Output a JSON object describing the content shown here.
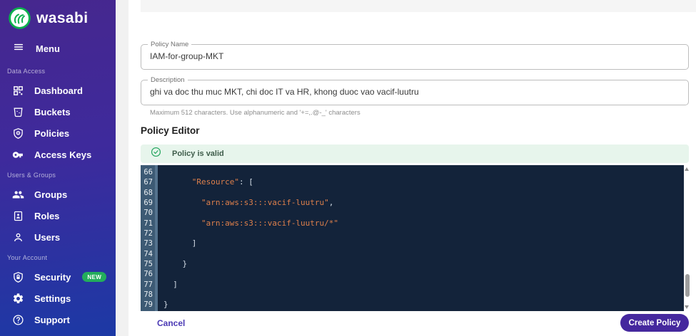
{
  "colors": {
    "sidebar-top": "#46278e",
    "sidebar-bottom": "#1c39a5",
    "accent-purple": "#45289e",
    "logo-green": "#0cb04d",
    "badge-green": "#23ad5c",
    "banner-bg": "#e7f5ec",
    "banner-green": "#2aa863",
    "editor-bg": "#13233a",
    "gutter-bg": "#3d5a74",
    "gutter-fold": "#54738e",
    "code-string": "#dd7f4b",
    "code-punct": "#d3dce6"
  },
  "brand": {
    "name": "wasabi",
    "logo_icon": "wasabi-logo-icon"
  },
  "sidebar": {
    "menu_label": "Menu",
    "menu_icon": "hamburger-menu-icon",
    "sections": [
      {
        "label": "Data Access",
        "items": [
          {
            "label": "Dashboard",
            "icon": "dashboard-icon"
          },
          {
            "label": "Buckets",
            "icon": "bucket-icon"
          },
          {
            "label": "Policies",
            "icon": "policy-shield-icon"
          },
          {
            "label": "Access Keys",
            "icon": "key-icon"
          }
        ]
      },
      {
        "label": "Users & Groups",
        "items": [
          {
            "label": "Groups",
            "icon": "groups-icon"
          },
          {
            "label": "Roles",
            "icon": "role-badge-icon"
          },
          {
            "label": "Users",
            "icon": "user-icon"
          }
        ]
      },
      {
        "label": "Your Account",
        "items": [
          {
            "label": "Security",
            "icon": "security-shield-icon",
            "badge": "NEW"
          },
          {
            "label": "Settings",
            "icon": "gear-icon"
          },
          {
            "label": "Support",
            "icon": "help-icon"
          }
        ]
      }
    ]
  },
  "form": {
    "policy_name": {
      "label": "Policy Name",
      "value": "IAM-for-group-MKT"
    },
    "description": {
      "label": "Description",
      "value": "ghi va doc thu muc MKT, chi doc IT va HR, khong duoc vao vacif-luutru",
      "helper": "Maximum 512 characters. Use alphanumeric and '+=,.@-_' characters"
    }
  },
  "editor": {
    "heading": "Policy Editor",
    "status": {
      "text": "Policy is valid",
      "icon": "check-circle-icon"
    },
    "code_lines": [
      {
        "n": 66,
        "t": ""
      },
      {
        "n": 67,
        "t": "      \"Resource\": ["
      },
      {
        "n": 68,
        "t": ""
      },
      {
        "n": 69,
        "t": "        \"arn:aws:s3:::vacif-luutru\","
      },
      {
        "n": 70,
        "t": ""
      },
      {
        "n": 71,
        "t": "        \"arn:aws:s3:::vacif-luutru/*\""
      },
      {
        "n": 72,
        "t": ""
      },
      {
        "n": 73,
        "t": "      ]"
      },
      {
        "n": 74,
        "t": ""
      },
      {
        "n": 75,
        "t": "    }"
      },
      {
        "n": 76,
        "t": ""
      },
      {
        "n": 77,
        "t": "  ]"
      },
      {
        "n": 78,
        "t": ""
      },
      {
        "n": 79,
        "t": "}"
      }
    ]
  },
  "footer": {
    "cancel_label": "Cancel",
    "create_label": "Create Policy"
  }
}
